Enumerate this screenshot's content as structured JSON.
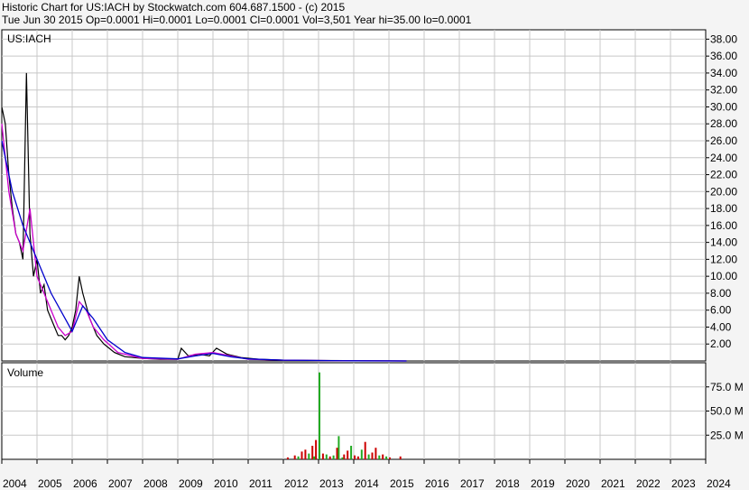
{
  "header": {
    "line1": "Historic Chart for US:IACH by Stockwatch.com 604.687.1500 - (c) 2015",
    "line2": "Tue Jun 30 2015   Op=0.0001   Hi=0.0001   Lo=0.0001   Cl=0.0001   Vol=3,501   Year hi=35.00   lo=0.0001"
  },
  "colors": {
    "price": "#000000",
    "ma_short": "#cc00cc",
    "ma_long": "#0000cc",
    "vol_up": "#22aa22",
    "vol_down": "#cc0000",
    "grid": "#c8c8c8",
    "background": "#ffffff"
  },
  "chart_data": [
    {
      "type": "line",
      "label": "US:IACH",
      "x_ticks": [
        "2004",
        "2005",
        "2006",
        "2007",
        "2008",
        "2009",
        "2010",
        "2011",
        "2012",
        "2013",
        "2014",
        "2015",
        "2016",
        "2017",
        "2018",
        "2019",
        "2020",
        "2021",
        "2022",
        "2023",
        "2024"
      ],
      "y_ticks": [
        "38.00",
        "36.00",
        "34.00",
        "32.00",
        "30.00",
        "28.00",
        "26.00",
        "24.00",
        "22.00",
        "20.00",
        "18.00",
        "16.00",
        "14.00",
        "12.00",
        "10.00",
        "8.00",
        "6.00",
        "4.00",
        "2.00"
      ],
      "ylim": [
        0,
        39
      ],
      "grid": true,
      "series": [
        {
          "role": "price",
          "x": [
            2004.0,
            2004.1,
            2004.2,
            2004.3,
            2004.4,
            2004.5,
            2004.6,
            2004.7,
            2004.8,
            2004.9,
            2005.0,
            2005.1,
            2005.2,
            2005.3,
            2005.4,
            2005.5,
            2005.6,
            2005.7,
            2005.8,
            2005.9,
            2006.0,
            2006.1,
            2006.2,
            2006.3,
            2006.5,
            2006.7,
            2006.9,
            2007.2,
            2007.5,
            2008.0,
            2008.5,
            2009.0,
            2009.1,
            2009.3,
            2009.6,
            2009.9,
            2010.1,
            2010.4,
            2010.8,
            2011.3,
            2012.0,
            2013.0,
            2014.0,
            2015.0,
            2015.5
          ],
          "y": [
            30,
            28,
            22,
            18,
            15,
            14,
            12,
            34,
            15,
            10,
            12,
            8,
            9,
            6,
            5,
            4,
            3,
            3,
            2.5,
            3,
            4,
            6,
            10,
            8,
            5,
            3,
            2,
            1,
            0.5,
            0.3,
            0.2,
            0.2,
            1.5,
            0.6,
            0.8,
            0.6,
            1.5,
            0.8,
            0.4,
            0.2,
            0.1,
            0.05,
            0.03,
            0.01,
            0.0001
          ]
        },
        {
          "role": "ma_short",
          "x": [
            2004.0,
            2004.2,
            2004.4,
            2004.6,
            2004.8,
            2005.0,
            2005.2,
            2005.4,
            2005.6,
            2005.8,
            2006.0,
            2006.2,
            2006.4,
            2006.6,
            2006.9,
            2007.3,
            2008.0,
            2009.0,
            2009.5,
            2010.0,
            2010.5,
            2011.0,
            2012.0,
            2013.0,
            2014.0,
            2015.5
          ],
          "y": [
            28,
            20,
            15,
            13,
            18,
            10,
            8,
            6,
            4,
            3,
            3.5,
            7,
            6,
            4,
            2.5,
            1,
            0.3,
            0.2,
            0.8,
            1.0,
            0.6,
            0.2,
            0.1,
            0.05,
            0.02,
            0.0001
          ]
        },
        {
          "role": "ma_long",
          "x": [
            2004.0,
            2004.3,
            2004.6,
            2005.0,
            2005.4,
            2005.8,
            2006.0,
            2006.3,
            2006.6,
            2007.0,
            2007.5,
            2008.0,
            2009.0,
            2009.5,
            2010.0,
            2010.5,
            2011.0,
            2012.0,
            2013.0,
            2014.0,
            2015.5
          ],
          "y": [
            26,
            20,
            16,
            12,
            8,
            5,
            3.5,
            6.5,
            5,
            2.5,
            1,
            0.4,
            0.25,
            0.6,
            0.9,
            0.5,
            0.25,
            0.1,
            0.05,
            0.02,
            0.0001
          ]
        }
      ]
    },
    {
      "type": "bar",
      "label": "Volume",
      "y_ticks": [
        "75.0 M",
        "50.0 M",
        "25.0 M"
      ],
      "ylim": [
        0,
        100
      ],
      "series": [
        {
          "role": "vol_down",
          "x": [
            2012.1,
            2012.3,
            2012.5,
            2012.6,
            2012.8,
            2012.9,
            2013.1,
            2013.3,
            2013.5,
            2013.7,
            2013.8,
            2014.0,
            2014.1,
            2014.3,
            2014.5,
            2014.6,
            2014.8,
            2015.0,
            2015.3
          ],
          "y": [
            2,
            4,
            8,
            10,
            14,
            20,
            6,
            3,
            12,
            5,
            9,
            4,
            3,
            18,
            7,
            12,
            5,
            2,
            3
          ]
        },
        {
          "role": "vol_up",
          "x": [
            2012.4,
            2012.7,
            2012.85,
            2013.0,
            2013.2,
            2013.4,
            2013.55,
            2013.65,
            2013.9,
            2014.2,
            2014.4,
            2014.7,
            2014.9
          ],
          "y": [
            3,
            6,
            3,
            90,
            5,
            4,
            24,
            2,
            14,
            10,
            5,
            4,
            3
          ]
        }
      ]
    }
  ]
}
